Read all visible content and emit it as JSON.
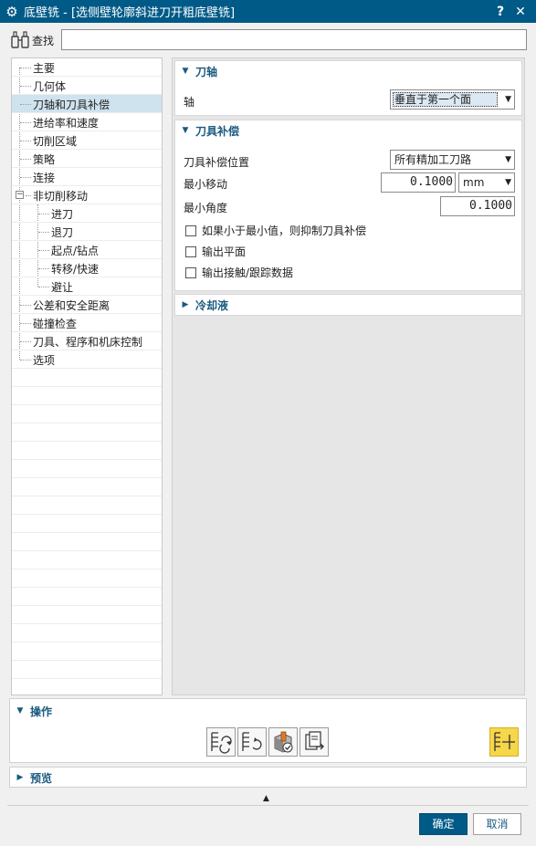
{
  "window": {
    "title": "底壁铣 - [选侧壁轮廓斜进刀开粗底壁铣]",
    "help_label": "?",
    "close_label": "✕"
  },
  "find": {
    "label": "查找",
    "value": "",
    "placeholder": ""
  },
  "tree": {
    "items": [
      {
        "label": "主要"
      },
      {
        "label": "几何体"
      },
      {
        "label": "刀轴和刀具补偿"
      },
      {
        "label": "进给率和速度"
      },
      {
        "label": "切削区域"
      },
      {
        "label": "策略"
      },
      {
        "label": "连接"
      },
      {
        "label": "非切削移动",
        "expander": "−"
      },
      {
        "label": "进刀"
      },
      {
        "label": "退刀"
      },
      {
        "label": "起点/钻点"
      },
      {
        "label": "转移/快速"
      },
      {
        "label": "避让"
      },
      {
        "label": "公差和安全距离"
      },
      {
        "label": "碰撞检查"
      },
      {
        "label": "刀具、程序和机床控制"
      },
      {
        "label": "选项"
      }
    ]
  },
  "tool_axis": {
    "header": "刀轴",
    "axis_label": "轴",
    "axis_value": "垂直于第一个面"
  },
  "tool_comp": {
    "header": "刀具补偿",
    "position_label": "刀具补偿位置",
    "position_value": "所有精加工刀路",
    "min_move_label": "最小移动",
    "min_move_value": "0.1000",
    "min_move_unit": "mm",
    "min_angle_label": "最小角度",
    "min_angle_value": "0.1000",
    "chk_suppress": "如果小于最小值，则抑制刀具补偿",
    "chk_output_plane": "输出平面",
    "chk_output_contact": "输出接触/跟踪数据"
  },
  "coolant": {
    "header": "冷却液"
  },
  "operations": {
    "header": "操作"
  },
  "preview": {
    "header": "预览"
  },
  "buttons": {
    "ok": "确定",
    "cancel": "取消"
  }
}
